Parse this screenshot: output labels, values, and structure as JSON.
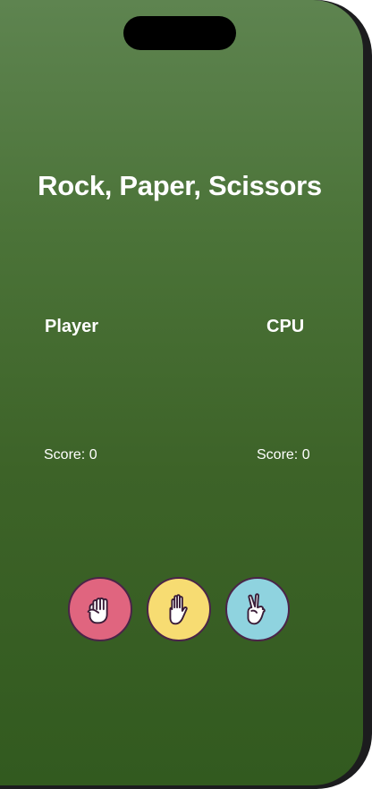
{
  "app": {
    "title": "Rock, Paper, Scissors"
  },
  "player": {
    "label": "Player",
    "score_text": "Score: 0"
  },
  "cpu": {
    "label": "CPU",
    "score_text": "Score: 0"
  },
  "choices": [
    {
      "name": "rock",
      "icon": "fist-icon",
      "color": "#e0657f"
    },
    {
      "name": "paper",
      "icon": "open-hand-icon",
      "color": "#f7dc72"
    },
    {
      "name": "scissors",
      "icon": "peace-hand-icon",
      "color": "#8fd3df"
    }
  ],
  "colors": {
    "background_top": "#5e8450",
    "background_bottom": "#325a1f",
    "button_border": "#4a2448",
    "text": "#ffffff"
  }
}
